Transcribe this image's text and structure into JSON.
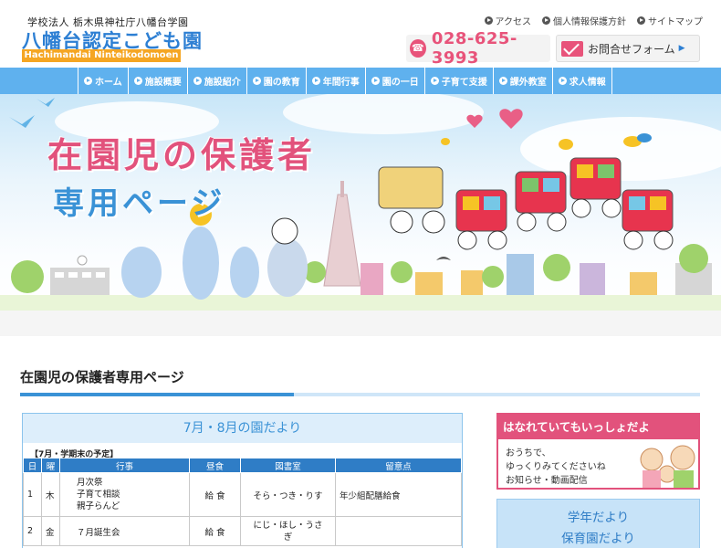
{
  "header": {
    "corp_name": "学校法人 栃木県神社庁八幡台学園",
    "logo_text": "八幡台認定こども園",
    "logo_sub": "Hachimandai Ninteikodomoen",
    "top_links": [
      "アクセス",
      "個人情報保護方針",
      "サイトマップ"
    ],
    "phone": "028-625-3993",
    "contact_label": "お問合せフォーム",
    "contact_arrow": "▶"
  },
  "nav": {
    "items": [
      "ホーム",
      "施設概要",
      "施設紹介",
      "園の教育",
      "年間行事",
      "園の一日",
      "子育て支援",
      "課外教室",
      "求人情報"
    ]
  },
  "hero": {
    "title": "在園児の保護者",
    "subtitle": "専用ページ"
  },
  "main": {
    "page_title": "在園児の保護者専用ページ",
    "news": {
      "heading": "7月・8月の園だより",
      "sub_heading": "【7月・学期末の予定】",
      "columns": [
        "日",
        "曜",
        "行事",
        "昼食",
        "図書室",
        "留意点"
      ],
      "rows": [
        {
          "day": "1",
          "dow": "木",
          "event1": "月次祭",
          "event2": "子育て相談",
          "event3": "親子らんど",
          "lunch": "給 食",
          "library": "そら・つき・りす",
          "note": "年少組配膳給食"
        },
        {
          "day": "2",
          "dow": "金",
          "event1": "７月誕生会",
          "lunch": "給 食",
          "library1": "にじ・ほし・うさ",
          "library2": "ぎ",
          "note": ""
        }
      ]
    }
  },
  "sidebar": {
    "banner_title": "はなれていてもいっしょだよ",
    "banner_line1": "おうちで、",
    "banner_line2": "ゆっくりみてくださいね",
    "banner_line3": "お知らせ・動画配信",
    "box_line1": "学年だより",
    "box_line2": "保育園だより"
  },
  "colors": {
    "accent_blue": "#3a92d6",
    "nav_blue": "#5fb1ee",
    "accent_pink": "#e2527c",
    "logo_orange": "#f5a623"
  },
  "icons": [
    "phone-icon",
    "mail-icon",
    "arrow-circle-icon"
  ]
}
